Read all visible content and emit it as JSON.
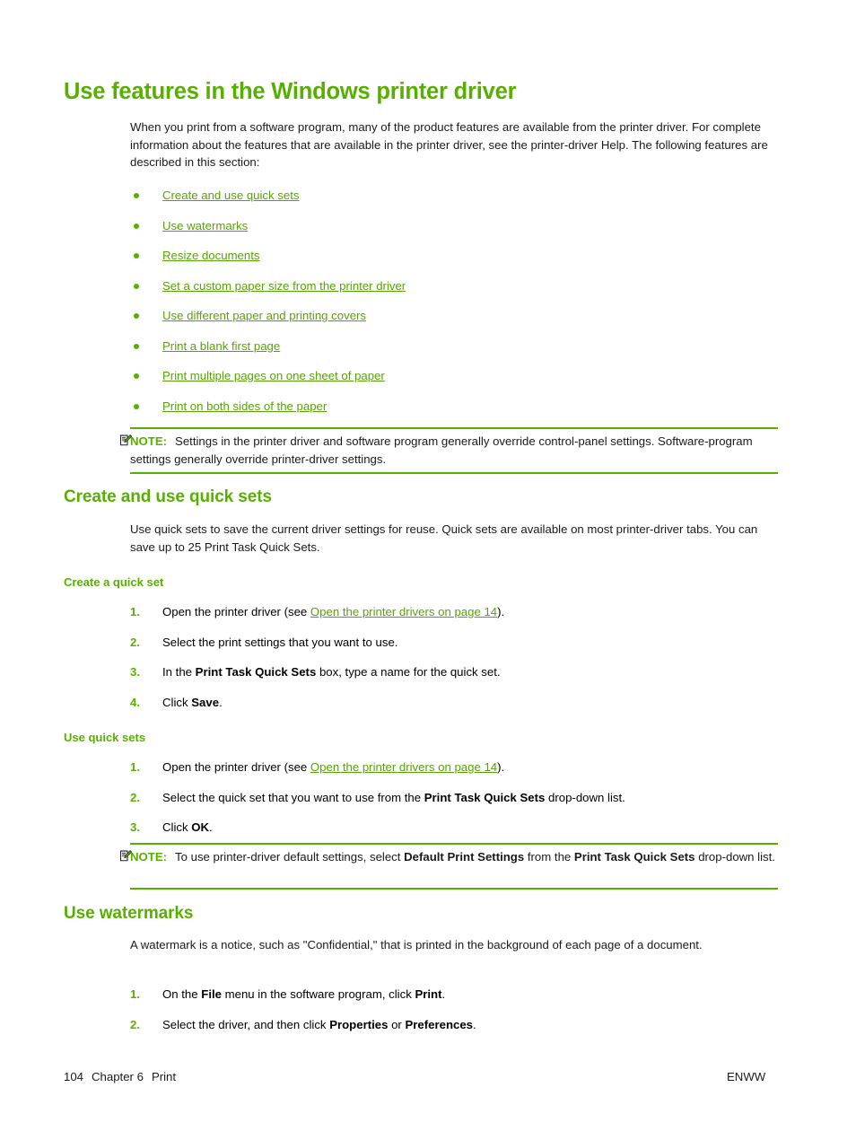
{
  "page": {
    "title": "Use features in the Windows printer driver",
    "intro": "When you print from a software program, many of the product features are available from the printer driver. For complete information about the features that are available in the printer driver, see the printer-driver Help. The following features are described in this section:"
  },
  "feature_links": [
    {
      "label": "Create and use quick sets"
    },
    {
      "label": "Use watermarks"
    },
    {
      "label": "Resize documents"
    },
    {
      "label": "Set a custom paper size from the printer driver"
    },
    {
      "label": "Use different paper and printing covers"
    },
    {
      "label": "Print a blank first page"
    },
    {
      "label": "Print multiple pages on one sheet of paper"
    },
    {
      "label": "Print on both sides of the paper"
    }
  ],
  "note1": {
    "label": "NOTE:",
    "text": "Settings in the printer driver and software program generally override control-panel settings. Software-program settings generally override printer-driver settings."
  },
  "quick_sets": {
    "heading": "Create and use quick sets",
    "paragraph": "Use quick sets to save the current driver settings for reuse. Quick sets are available on most printer-driver tabs. You can save up to 25 Print Task Quick Sets.",
    "create_heading": "Create a quick set",
    "create_steps": [
      {
        "num": "1.",
        "pre": "Open the printer driver (see ",
        "link": "Open the printer drivers on page 14",
        "post": ")."
      },
      {
        "num": "2.",
        "pre": "Select the print settings that you want to use.",
        "bold": "",
        "post": ""
      },
      {
        "num": "3.",
        "pre": "In the ",
        "bold": "Print Task Quick Sets",
        "post": " box, type a name for the quick set."
      },
      {
        "num": "4.",
        "pre": "Click ",
        "bold": "Save",
        "post": "."
      }
    ],
    "use_heading": "Use quick sets",
    "use_steps": [
      {
        "num": "1.",
        "pre": "Open the printer driver (see ",
        "link": "Open the printer drivers on page 14",
        "post": ")."
      },
      {
        "num": "2.",
        "pre": "Select the quick set that you want to use from the ",
        "bold": "Print Task Quick Sets",
        "post": " drop-down list."
      },
      {
        "num": "3.",
        "pre": "Click ",
        "bold": "OK",
        "post": "."
      }
    ]
  },
  "note2": {
    "label": "NOTE:",
    "pre": "To use printer-driver default settings, select ",
    "bold1": "Default Print Settings",
    "mid": " from the ",
    "bold2": "Print Task Quick Sets",
    "post": " drop-down list."
  },
  "watermarks": {
    "heading": "Use watermarks",
    "paragraph": "A watermark is a notice, such as \"Confidential,\" that is printed in the background of each page of a document.",
    "steps": [
      {
        "num": "1.",
        "pre": "On the ",
        "bold1": "File",
        "mid": " menu in the software program, click ",
        "bold2": "Print",
        "post": "."
      },
      {
        "num": "2.",
        "pre": "Select the driver, and then click ",
        "bold1": "Properties",
        "mid": " or ",
        "bold2": "Preferences",
        "post": "."
      }
    ]
  },
  "footer": {
    "page_number": "104",
    "chapter": "Chapter 6",
    "chapter_title": "Print",
    "locale": "ENWW"
  },
  "colors": {
    "accent_green": "#57b000",
    "link_green": "#57a406",
    "body_text": "#1a1a1a"
  },
  "icons": {
    "note": "note-pencil-icon"
  }
}
